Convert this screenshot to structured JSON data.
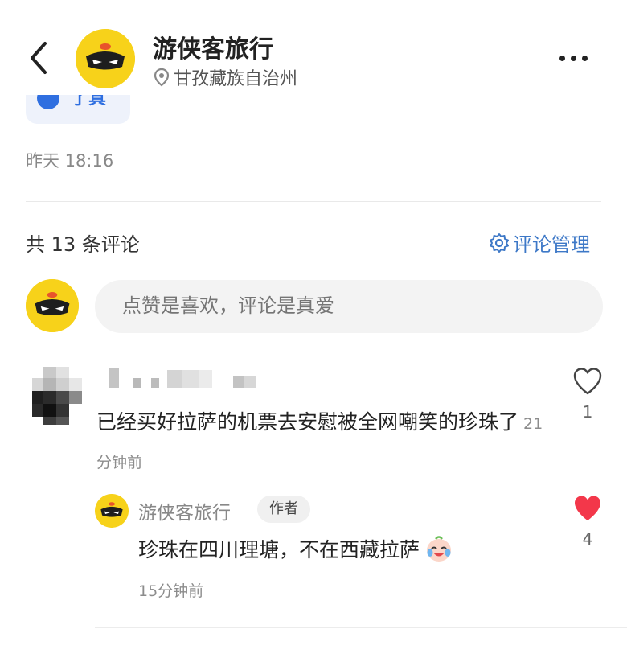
{
  "header": {
    "title": "游侠客旅行",
    "location": "甘孜藏族自治州",
    "back_icon": "chevron-left-icon",
    "more_icon": "more-horizontal-icon",
    "location_icon": "location-pin-icon"
  },
  "post": {
    "chip_partial_text": "了真",
    "date": "昨天 18:16"
  },
  "comments_section": {
    "count_text": "共 13 条评论",
    "manage_label": "评论管理",
    "input_placeholder": "点赞是喜欢，评论是真爱"
  },
  "comments": [
    {
      "text": "已经买好拉萨的机票去安慰被全网嘲笑的珍珠了",
      "time": "21分钟前",
      "likes": "1",
      "liked": false,
      "reply": {
        "name": "游侠客旅行",
        "tag": "作者",
        "text": "珍珠在四川理塘，不在西藏拉萨",
        "emoji": "crying-laughing-face-emoji",
        "time": "15分钟前",
        "likes": "4",
        "liked": true
      }
    }
  ],
  "colors": {
    "brand_yellow": "#f7d21a",
    "link_blue": "#3d78c7",
    "heart_red": "#f3374a"
  }
}
